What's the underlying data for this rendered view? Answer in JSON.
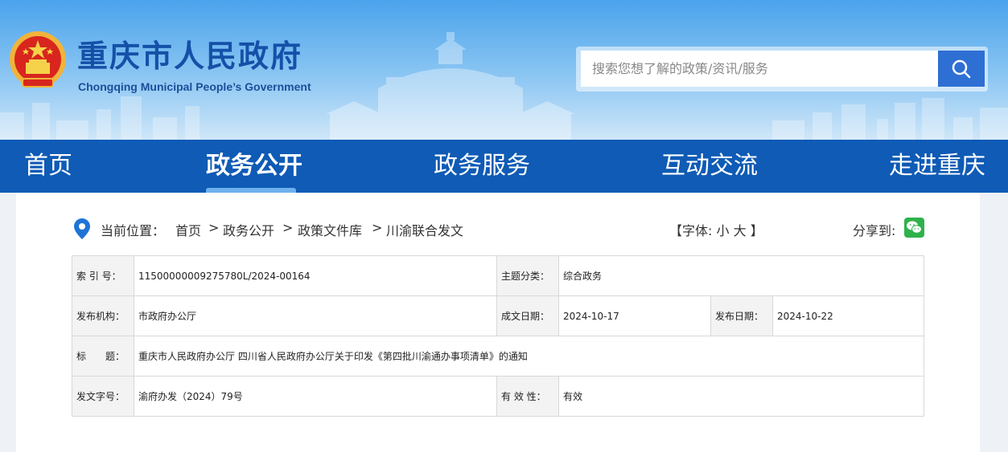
{
  "header": {
    "title": "重庆市人民政府",
    "subtitle": "Chongqing Municipal People’s Government",
    "emblem_icon": "national-emblem-icon"
  },
  "search": {
    "placeholder": "搜索您想了解的政策/资讯/服务",
    "button_icon": "search-icon"
  },
  "nav": {
    "items": [
      {
        "label": "首页"
      },
      {
        "label": "政务公开"
      },
      {
        "label": "政务服务"
      },
      {
        "label": "互动交流"
      },
      {
        "label": "走进重庆"
      }
    ],
    "active_index": 1
  },
  "breadcrumb": {
    "label": "当前位置：",
    "items": [
      "首页",
      "政务公开",
      "政策文件库",
      "川渝联合发文"
    ],
    "separator": ">"
  },
  "font_size": {
    "open": "【字体:",
    "small": "小",
    "large": "大",
    "close": "】"
  },
  "share": {
    "label": "分享到:",
    "icon": "wechat-icon"
  },
  "info_table": {
    "index_label": "索 引 号：",
    "index_value": "11500000009275780L/2024-00164",
    "topic_label": "主题分类：",
    "topic_value": "综合政务",
    "issuer_label": "发布机构：",
    "issuer_value": "市政府办公厅",
    "written_date_label": "成文日期：",
    "written_date_value": "2024-10-17",
    "publish_date_label": "发布日期：",
    "publish_date_value": "2024-10-22",
    "title_label": "标　　题：",
    "title_value": "重庆市人民政府办公厅 四川省人民政府办公厅关于印发《第四批川渝通办事项清单》的通知",
    "doc_no_label": "发文字号：",
    "doc_no_value": "渝府办发（2024）79号",
    "validity_label": "有 效 性：",
    "validity_value": "有效"
  },
  "colors": {
    "nav_bg": "#0f5bb5",
    "title_blue": "#1550a8",
    "search_button": "#2e6fd4",
    "wechat_green": "#2fb24c"
  }
}
